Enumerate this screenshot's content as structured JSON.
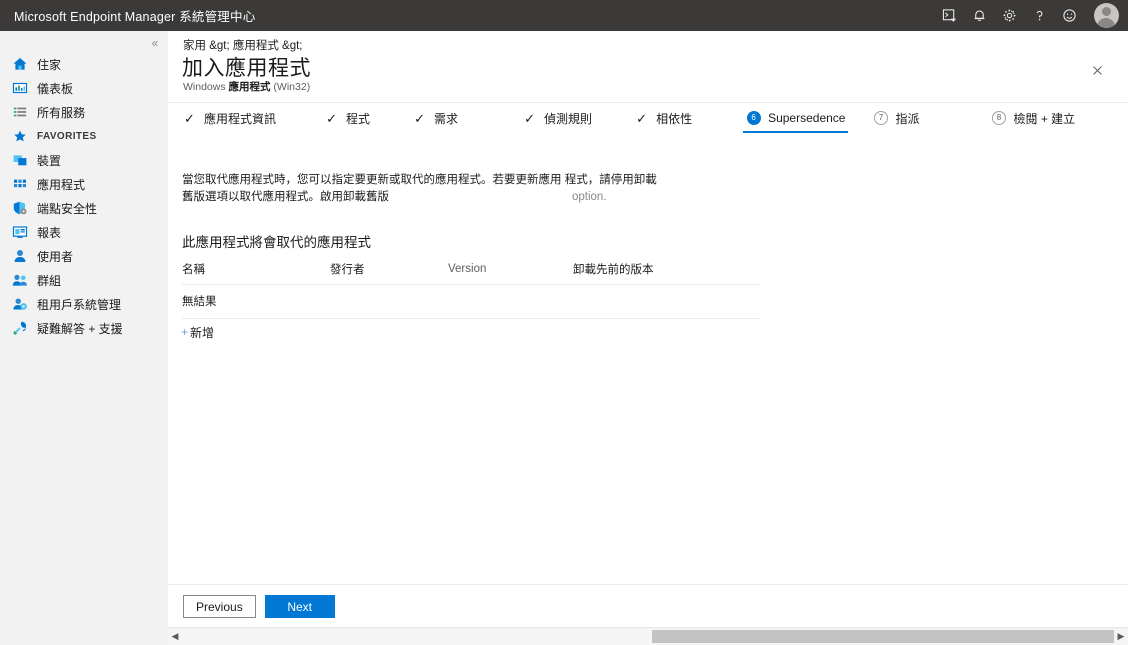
{
  "topbar": {
    "title": "Microsoft Endpoint Manager 系統管理中心",
    "icons": [
      {
        "name": "cloud-shell-icon",
        "glyph": "cloud-shell"
      },
      {
        "name": "notifications-icon",
        "glyph": "bell"
      },
      {
        "name": "settings-icon",
        "glyph": "gear"
      },
      {
        "name": "help-icon",
        "glyph": "question"
      },
      {
        "name": "feedback-icon",
        "glyph": "smiley"
      }
    ],
    "avatar_label": "avatar"
  },
  "sidebar": {
    "collapse_glyph": "«",
    "items": [
      {
        "label": "住家",
        "icon": "home-icon"
      },
      {
        "label": "儀表板",
        "icon": "dashboard-icon"
      },
      {
        "label": "所有服務",
        "icon": "all-services-icon"
      },
      {
        "label": "FAVORITES",
        "icon": "star-icon"
      },
      {
        "label": "裝置",
        "icon": "devices-icon"
      },
      {
        "label": "應用程式",
        "icon": "apps-icon"
      },
      {
        "label": "端點安全性",
        "icon": "endpoint-security-icon"
      },
      {
        "label": "報表",
        "icon": "reports-icon"
      },
      {
        "label": "使用者",
        "icon": "users-icon"
      },
      {
        "label": "群組",
        "icon": "groups-icon"
      },
      {
        "label": "租用戶系統管理",
        "icon": "tenant-admin-icon"
      },
      {
        "label": "疑難解答 + 支援",
        "icon": "troubleshoot-icon"
      }
    ]
  },
  "blade": {
    "breadcrumb": "家用 &gt; 應用程式 &gt;",
    "title": "加入應用程式",
    "subtitle_prefix": "Windows ",
    "subtitle_strong": "應用程式",
    "subtitle_suffix": " (Win32)",
    "close_label": "✕"
  },
  "wizard": {
    "tabs": [
      {
        "label": "應用程式資訊",
        "state": "complete",
        "number": "1"
      },
      {
        "label": "程式",
        "state": "complete",
        "number": "2"
      },
      {
        "label": "需求",
        "state": "complete",
        "number": "3"
      },
      {
        "label": "偵測規則",
        "state": "complete",
        "number": "4"
      },
      {
        "label": "相依性",
        "state": "complete",
        "number": "5"
      },
      {
        "label": "Supersedence",
        "state": "active",
        "number": "6"
      },
      {
        "label": "指派",
        "state": "pending",
        "number": "7"
      },
      {
        "label": "檢閱 + 建立",
        "state": "pending",
        "number": "8"
      }
    ],
    "check_glyph": "✓"
  },
  "body": {
    "description_line1": "當您取代應用程式時，您可以指定要更新或取代的應用程式。若要更新應用",
    "description_line2": "程式，請停用卸載舊版選項以取代應用程式。啟用卸載舊版",
    "description_trailing": "option.",
    "section_heading": "此應用程式將會取代的應用程式",
    "table": {
      "columns": [
        "名稱",
        "發行者",
        "Version",
        "卸載先前的版本"
      ],
      "empty_text": "無結果",
      "rows": []
    },
    "add_plus": "+",
    "add_label": "新增"
  },
  "footer": {
    "previous_label": "Previous",
    "next_label": "Next"
  },
  "scrollbar": {
    "left_arrow": "◀",
    "right_arrow": "▶"
  },
  "colors": {
    "accent": "#0078d4",
    "topbar_bg": "#3b3a39",
    "sidebar_bg": "#f2f2f2",
    "link": "#0078d4"
  }
}
